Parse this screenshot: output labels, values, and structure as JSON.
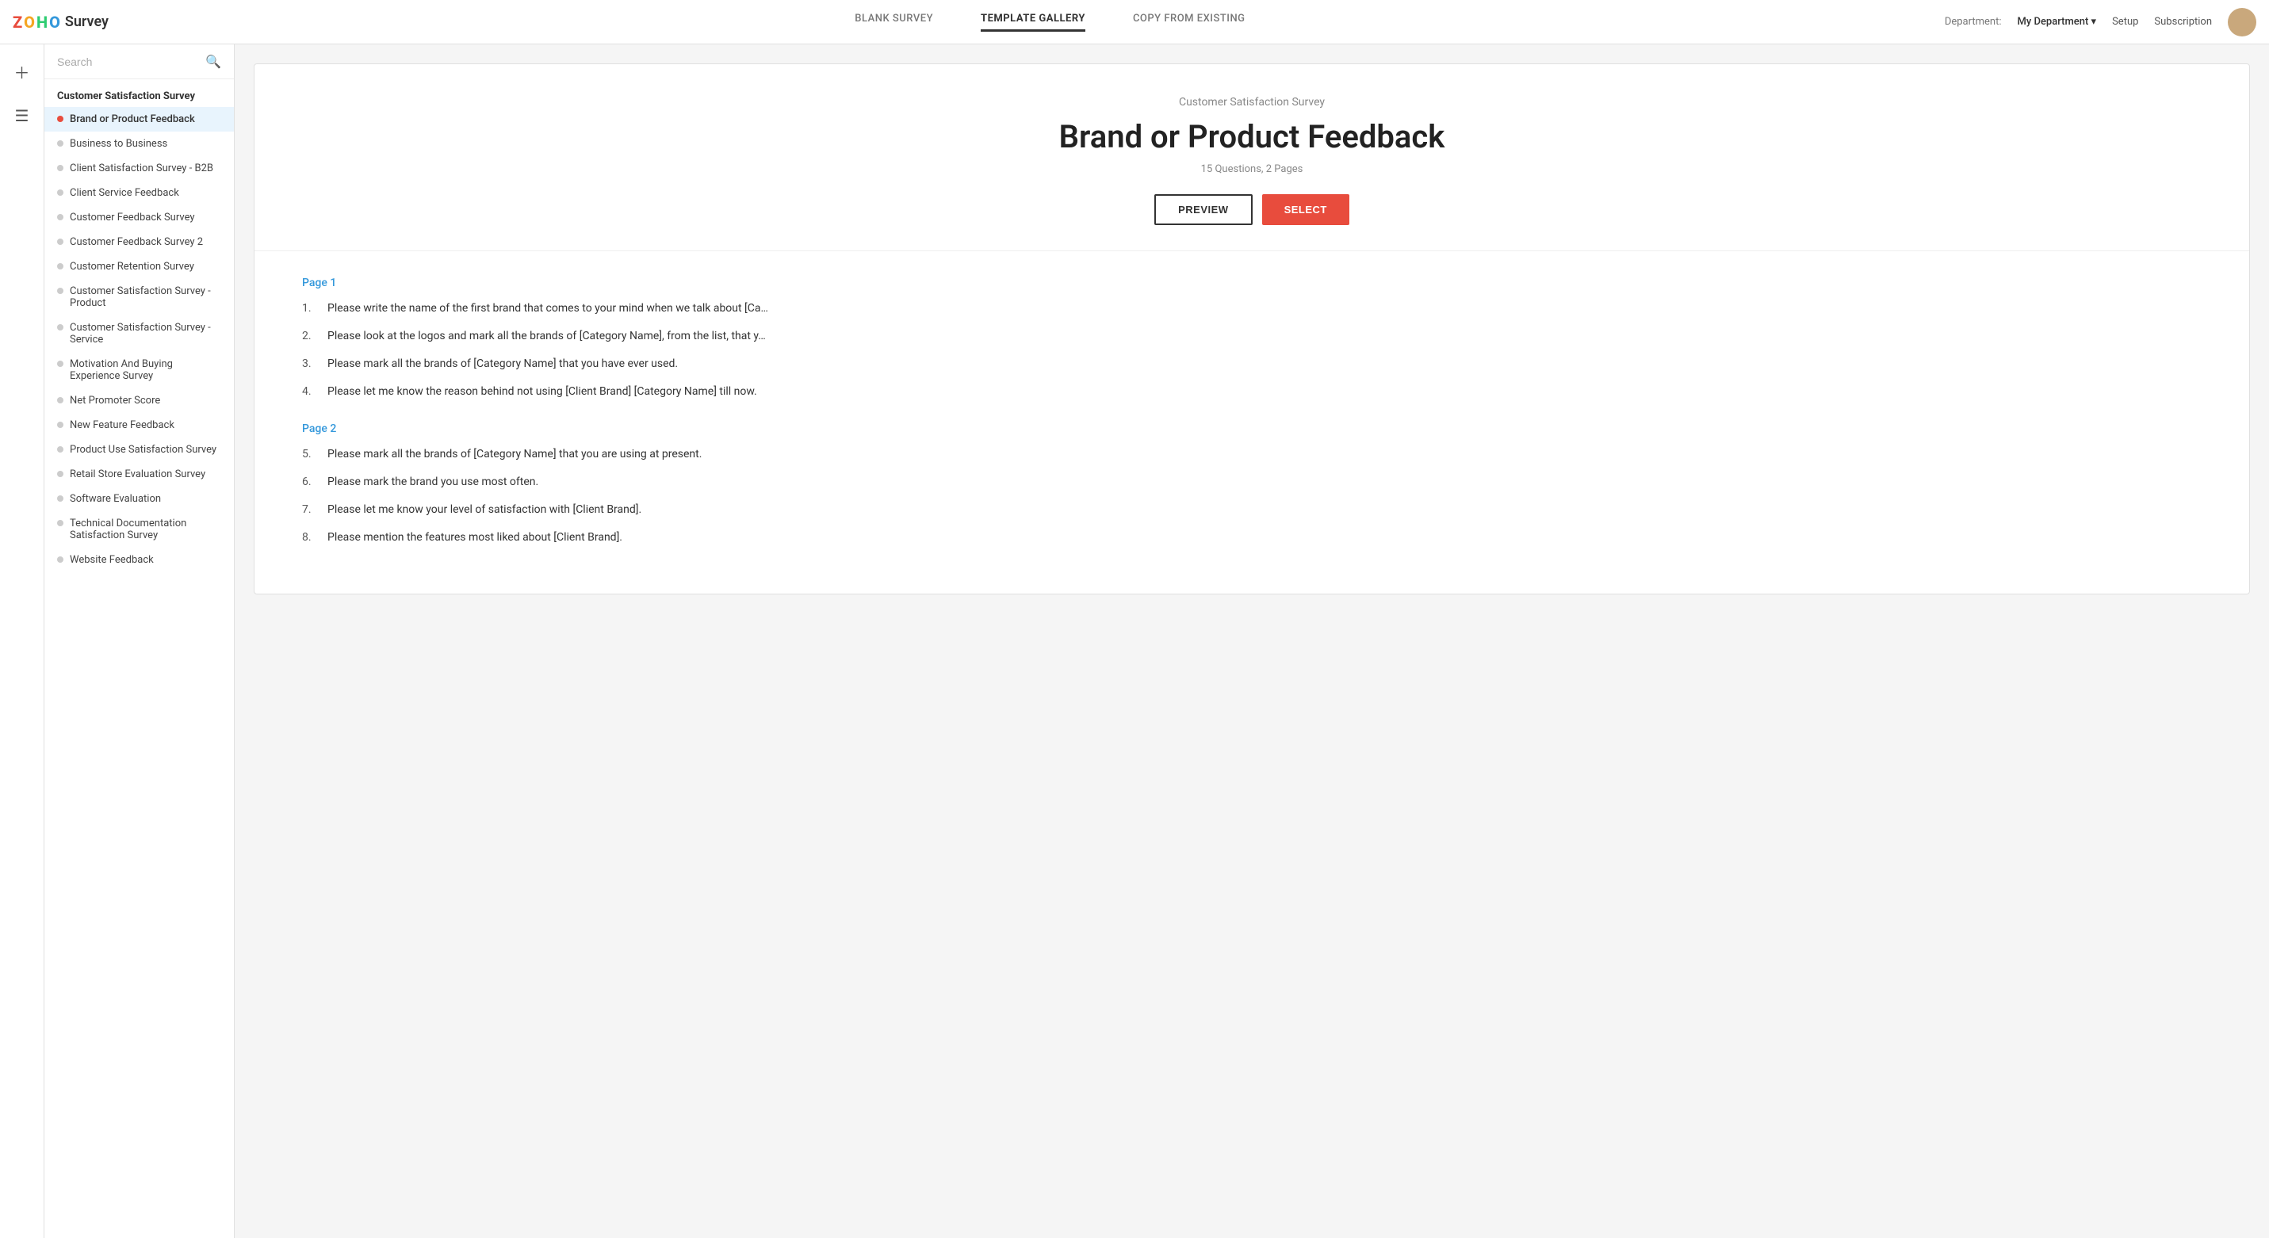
{
  "app": {
    "logo_z": "Z",
    "logo_o1": "O",
    "logo_h": "H",
    "logo_o2": "O",
    "logo_survey": "Survey"
  },
  "nav": {
    "tabs": [
      {
        "id": "blank",
        "label": "BLANK SURVEY",
        "active": false
      },
      {
        "id": "template",
        "label": "TEMPLATE GALLERY",
        "active": true
      },
      {
        "id": "copy",
        "label": "COPY FROM EXISTING",
        "active": false
      }
    ],
    "department_label": "Department:",
    "department_name": "My Department",
    "setup": "Setup",
    "subscription": "Subscription"
  },
  "sidebar": {
    "search_placeholder": "Search",
    "category": "Customer Satisfaction Survey",
    "items": [
      {
        "id": "brand-product",
        "label": "Brand or Product Feedback",
        "active": true
      },
      {
        "id": "b2b",
        "label": "Business to Business",
        "active": false
      },
      {
        "id": "client-b2b",
        "label": "Client Satisfaction Survey - B2B",
        "active": false
      },
      {
        "id": "client-service",
        "label": "Client Service Feedback",
        "active": false
      },
      {
        "id": "customer-feedback",
        "label": "Customer Feedback Survey",
        "active": false
      },
      {
        "id": "customer-feedback-2",
        "label": "Customer Feedback Survey 2",
        "active": false
      },
      {
        "id": "customer-retention",
        "label": "Customer Retention Survey",
        "active": false
      },
      {
        "id": "csat-product",
        "label": "Customer Satisfaction Survey - Product",
        "active": false
      },
      {
        "id": "csat-service",
        "label": "Customer Satisfaction Survey - Service",
        "active": false
      },
      {
        "id": "motivation",
        "label": "Motivation And Buying Experience Survey",
        "active": false
      },
      {
        "id": "nps",
        "label": "Net Promoter Score",
        "active": false
      },
      {
        "id": "new-feature",
        "label": "New Feature Feedback",
        "active": false
      },
      {
        "id": "product-use",
        "label": "Product Use Satisfaction Survey",
        "active": false
      },
      {
        "id": "retail",
        "label": "Retail Store Evaluation Survey",
        "active": false
      },
      {
        "id": "software",
        "label": "Software Evaluation",
        "active": false
      },
      {
        "id": "tech-doc",
        "label": "Technical Documentation Satisfaction Survey",
        "active": false
      },
      {
        "id": "website",
        "label": "Website Feedback",
        "active": false
      }
    ]
  },
  "preview": {
    "category_title": "Customer Satisfaction Survey",
    "survey_title": "Brand or Product Feedback",
    "meta": "15 Questions, 2 Pages",
    "btn_preview": "PREVIEW",
    "btn_select": "SELECT",
    "pages": [
      {
        "label": "Page 1",
        "questions": [
          {
            "num": "1.",
            "text": "Please write the name of the first brand that comes to your mind when we talk about [Ca…"
          },
          {
            "num": "2.",
            "text": "Please look at the logos and mark all the brands of [Category Name], from the list, that y…"
          },
          {
            "num": "3.",
            "text": "Please mark all the brands of [Category Name] that you have ever used."
          },
          {
            "num": "4.",
            "text": "Please let me know the reason behind not using [Client Brand] [Category Name] till now."
          }
        ]
      },
      {
        "label": "Page 2",
        "questions": [
          {
            "num": "5.",
            "text": "Please mark all the brands of [Category Name] that you are using at present."
          },
          {
            "num": "6.",
            "text": "Please mark the brand you use most often."
          },
          {
            "num": "7.",
            "text": "Please let me know your level of satisfaction with [Client Brand]."
          },
          {
            "num": "8.",
            "text": "Please mention the features most liked about [Client Brand]."
          }
        ]
      }
    ]
  }
}
